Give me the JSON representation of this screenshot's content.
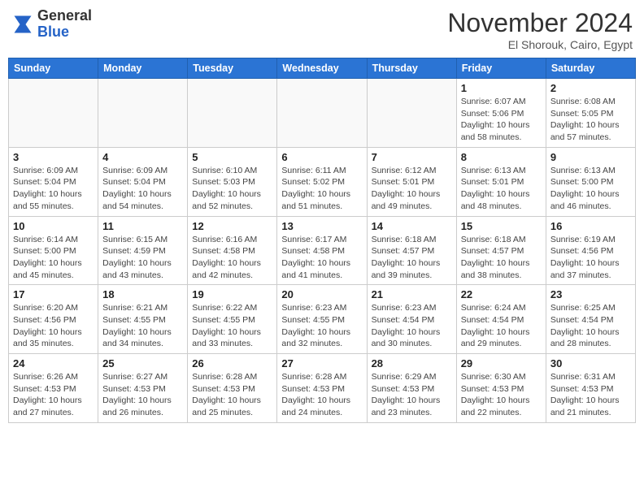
{
  "header": {
    "logo_line1": "General",
    "logo_line2": "Blue",
    "month": "November 2024",
    "location": "El Shorouk, Cairo, Egypt"
  },
  "weekdays": [
    "Sunday",
    "Monday",
    "Tuesday",
    "Wednesday",
    "Thursday",
    "Friday",
    "Saturday"
  ],
  "weeks": [
    [
      {
        "day": "",
        "info": ""
      },
      {
        "day": "",
        "info": ""
      },
      {
        "day": "",
        "info": ""
      },
      {
        "day": "",
        "info": ""
      },
      {
        "day": "",
        "info": ""
      },
      {
        "day": "1",
        "info": "Sunrise: 6:07 AM\nSunset: 5:06 PM\nDaylight: 10 hours and 58 minutes."
      },
      {
        "day": "2",
        "info": "Sunrise: 6:08 AM\nSunset: 5:05 PM\nDaylight: 10 hours and 57 minutes."
      }
    ],
    [
      {
        "day": "3",
        "info": "Sunrise: 6:09 AM\nSunset: 5:04 PM\nDaylight: 10 hours and 55 minutes."
      },
      {
        "day": "4",
        "info": "Sunrise: 6:09 AM\nSunset: 5:04 PM\nDaylight: 10 hours and 54 minutes."
      },
      {
        "day": "5",
        "info": "Sunrise: 6:10 AM\nSunset: 5:03 PM\nDaylight: 10 hours and 52 minutes."
      },
      {
        "day": "6",
        "info": "Sunrise: 6:11 AM\nSunset: 5:02 PM\nDaylight: 10 hours and 51 minutes."
      },
      {
        "day": "7",
        "info": "Sunrise: 6:12 AM\nSunset: 5:01 PM\nDaylight: 10 hours and 49 minutes."
      },
      {
        "day": "8",
        "info": "Sunrise: 6:13 AM\nSunset: 5:01 PM\nDaylight: 10 hours and 48 minutes."
      },
      {
        "day": "9",
        "info": "Sunrise: 6:13 AM\nSunset: 5:00 PM\nDaylight: 10 hours and 46 minutes."
      }
    ],
    [
      {
        "day": "10",
        "info": "Sunrise: 6:14 AM\nSunset: 5:00 PM\nDaylight: 10 hours and 45 minutes."
      },
      {
        "day": "11",
        "info": "Sunrise: 6:15 AM\nSunset: 4:59 PM\nDaylight: 10 hours and 43 minutes."
      },
      {
        "day": "12",
        "info": "Sunrise: 6:16 AM\nSunset: 4:58 PM\nDaylight: 10 hours and 42 minutes."
      },
      {
        "day": "13",
        "info": "Sunrise: 6:17 AM\nSunset: 4:58 PM\nDaylight: 10 hours and 41 minutes."
      },
      {
        "day": "14",
        "info": "Sunrise: 6:18 AM\nSunset: 4:57 PM\nDaylight: 10 hours and 39 minutes."
      },
      {
        "day": "15",
        "info": "Sunrise: 6:18 AM\nSunset: 4:57 PM\nDaylight: 10 hours and 38 minutes."
      },
      {
        "day": "16",
        "info": "Sunrise: 6:19 AM\nSunset: 4:56 PM\nDaylight: 10 hours and 37 minutes."
      }
    ],
    [
      {
        "day": "17",
        "info": "Sunrise: 6:20 AM\nSunset: 4:56 PM\nDaylight: 10 hours and 35 minutes."
      },
      {
        "day": "18",
        "info": "Sunrise: 6:21 AM\nSunset: 4:55 PM\nDaylight: 10 hours and 34 minutes."
      },
      {
        "day": "19",
        "info": "Sunrise: 6:22 AM\nSunset: 4:55 PM\nDaylight: 10 hours and 33 minutes."
      },
      {
        "day": "20",
        "info": "Sunrise: 6:23 AM\nSunset: 4:55 PM\nDaylight: 10 hours and 32 minutes."
      },
      {
        "day": "21",
        "info": "Sunrise: 6:23 AM\nSunset: 4:54 PM\nDaylight: 10 hours and 30 minutes."
      },
      {
        "day": "22",
        "info": "Sunrise: 6:24 AM\nSunset: 4:54 PM\nDaylight: 10 hours and 29 minutes."
      },
      {
        "day": "23",
        "info": "Sunrise: 6:25 AM\nSunset: 4:54 PM\nDaylight: 10 hours and 28 minutes."
      }
    ],
    [
      {
        "day": "24",
        "info": "Sunrise: 6:26 AM\nSunset: 4:53 PM\nDaylight: 10 hours and 27 minutes."
      },
      {
        "day": "25",
        "info": "Sunrise: 6:27 AM\nSunset: 4:53 PM\nDaylight: 10 hours and 26 minutes."
      },
      {
        "day": "26",
        "info": "Sunrise: 6:28 AM\nSunset: 4:53 PM\nDaylight: 10 hours and 25 minutes."
      },
      {
        "day": "27",
        "info": "Sunrise: 6:28 AM\nSunset: 4:53 PM\nDaylight: 10 hours and 24 minutes."
      },
      {
        "day": "28",
        "info": "Sunrise: 6:29 AM\nSunset: 4:53 PM\nDaylight: 10 hours and 23 minutes."
      },
      {
        "day": "29",
        "info": "Sunrise: 6:30 AM\nSunset: 4:53 PM\nDaylight: 10 hours and 22 minutes."
      },
      {
        "day": "30",
        "info": "Sunrise: 6:31 AM\nSunset: 4:53 PM\nDaylight: 10 hours and 21 minutes."
      }
    ]
  ]
}
